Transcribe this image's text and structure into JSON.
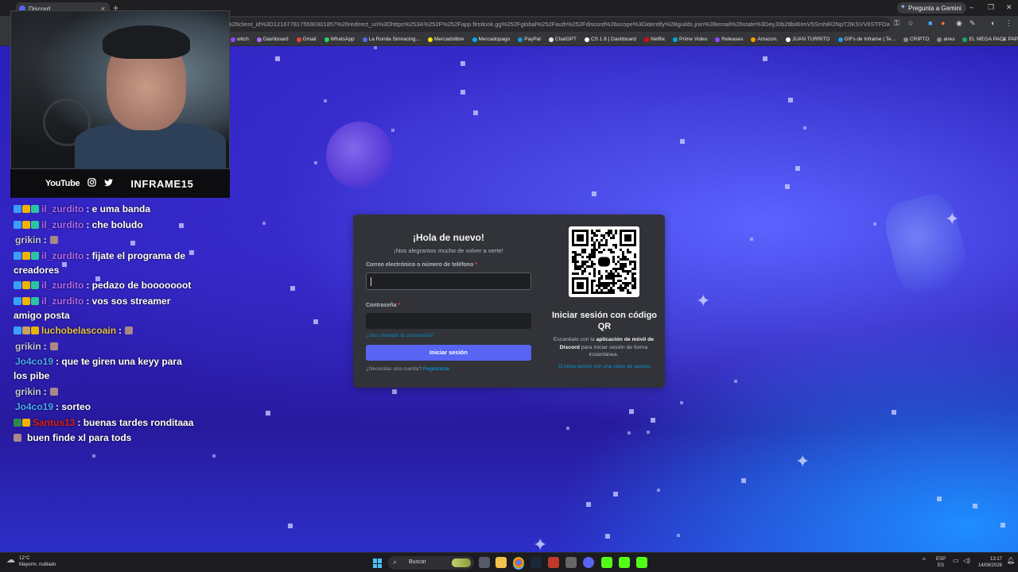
{
  "browser": {
    "tab_title": "Discord",
    "tab_close": "×",
    "new_tab": "+",
    "gemini_label": "Pregunta a Gemini",
    "url": "sponse_type%3Dcode%26client_id%3D1216778175590301857%26redirect_uri%3Dhttps%253A%252F%252Fapp.firstlook.gg%252Fglobal%252Fauth%252Fdiscord%26scope%3Didentify%2Bguilds.join%2Bemail%26state%3DeyJ0b2tlbiI6ImV5SmhiR2NpT2lKSVV6STFOa",
    "bookmarks": [
      {
        "label": "witch",
        "color": "#9146ff"
      },
      {
        "label": "Dashboard",
        "color": "#a970ff"
      },
      {
        "label": "Gmail",
        "color": "#ea4335"
      },
      {
        "label": "WhatsApp",
        "color": "#25d366"
      },
      {
        "label": "La Ronda Simracing...",
        "color": "#5865f2"
      },
      {
        "label": "Mercadolibre",
        "color": "#ffe600"
      },
      {
        "label": "Mercadopago",
        "color": "#00b1ea"
      },
      {
        "label": "PayPal",
        "color": "#169bd7"
      },
      {
        "label": "ChatGPT",
        "color": "#e5e5e5"
      },
      {
        "label": "CS 1.6 | Dashboard",
        "color": "#ffffff"
      },
      {
        "label": "Netflix",
        "color": "#e50914"
      },
      {
        "label": "Prime Video",
        "color": "#00a8e1"
      },
      {
        "label": "Releases",
        "color": "#9146ff"
      },
      {
        "label": "Amazon.",
        "color": "#ff9900"
      },
      {
        "label": "JUAN TURRITO",
        "color": "#ffffff"
      },
      {
        "label": "GIFs de Inframe | Te...",
        "color": "#1e9bf0"
      },
      {
        "label": "CRIPTO",
        "color": "#888888"
      },
      {
        "label": "aires",
        "color": "#888888"
      },
      {
        "label": "EL MEGA PACK PAP...",
        "color": "#1fa463"
      }
    ]
  },
  "overlay": {
    "youtube_label": "YouTube",
    "instagram_icon": "instagram-icon",
    "twitter_icon": "twitter-icon",
    "channel_name": "INFRAME15"
  },
  "chat": [
    {
      "user": "il_zurdito",
      "user_color": "#b068ff",
      "text": ": e uma banda",
      "badges": [
        "#3aa0ff",
        "#f0b400",
        "#2cc4a0"
      ]
    },
    {
      "user": "il_zurdito",
      "user_color": "#b068ff",
      "text": ": che boludo",
      "badges": [
        "#3aa0ff",
        "#f0b400",
        "#2cc4a0"
      ]
    },
    {
      "user": "grikin",
      "user_color": "#c7c7d9",
      "text": ":",
      "badges": [],
      "emote": true
    },
    {
      "user": "il_zurdito",
      "user_color": "#b068ff",
      "text": ": fijate el programa de creadores",
      "badges": [
        "#3aa0ff",
        "#f0b400",
        "#2cc4a0"
      ]
    },
    {
      "user": "il_zurdito",
      "user_color": "#b068ff",
      "text": ": pedazo de booooooot",
      "badges": [
        "#3aa0ff",
        "#f0b400",
        "#2cc4a0"
      ]
    },
    {
      "user": "il_zurdito",
      "user_color": "#b068ff",
      "text": ": vos sos streamer amigo posta",
      "badges": [
        "#3aa0ff",
        "#f0b400",
        "#2cc4a0"
      ]
    },
    {
      "user": "luchobelascoain",
      "user_color": "#e7c14a",
      "text": ":",
      "badges": [
        "#3aa0ff",
        "#c9a060",
        "#e7b400"
      ],
      "emote": true
    },
    {
      "user": "grikin",
      "user_color": "#c7c7d9",
      "text": ":",
      "badges": [],
      "emote": true
    },
    {
      "user": "Jo4co19",
      "user_color": "#4aa8ff",
      "text": ": que te giren una keyy para los pibe",
      "badges": []
    },
    {
      "user": "grikin",
      "user_color": "#c7c7d9",
      "text": ":",
      "badges": [],
      "emote": true
    },
    {
      "user": "Jo4co19",
      "user_color": "#4aa8ff",
      "text": ": sorteo",
      "badges": []
    },
    {
      "user": "Santus13",
      "user_color": "#e02020",
      "text": ": buenas tardes ronditaaa",
      "badges": [
        "#2d8a4a",
        "#f0b400"
      ]
    },
    {
      "user": "",
      "user_color": "#ffffff",
      "text": "buen finde xl para tods",
      "badges": [],
      "lead_emote": true
    }
  ],
  "login": {
    "title": "¡Hola de nuevo!",
    "subtitle": "¡Nos alegramos mucho de volver a verte!",
    "email_label": "Correo electrónico o número de teléfono",
    "password_label": "Contraseña",
    "required_mark": "*",
    "forgot_link": "¿Has olvidado la contraseña?",
    "submit_label": "Iniciar sesión",
    "register_prompt": "¿Necesitas una cuenta?",
    "register_link": "Registrarse",
    "qr_title": "Iniciar sesión con código QR",
    "qr_desc_pre": "Escanéalo con la",
    "qr_desc_bold": "aplicación de móvil de Discord",
    "qr_desc_post": "para iniciar sesión de forma instantánea.",
    "passkey_link": "O inicia sesión con una clave de acceso",
    "accent_color": "#5865f2"
  },
  "taskbar": {
    "temp": "12°C",
    "weather": "Mayorm. nublado",
    "search_placeholder": "Buscar",
    "lang_top": "ESP",
    "lang_bottom": "ES",
    "time": "13:17",
    "date": "14/08/2026"
  }
}
